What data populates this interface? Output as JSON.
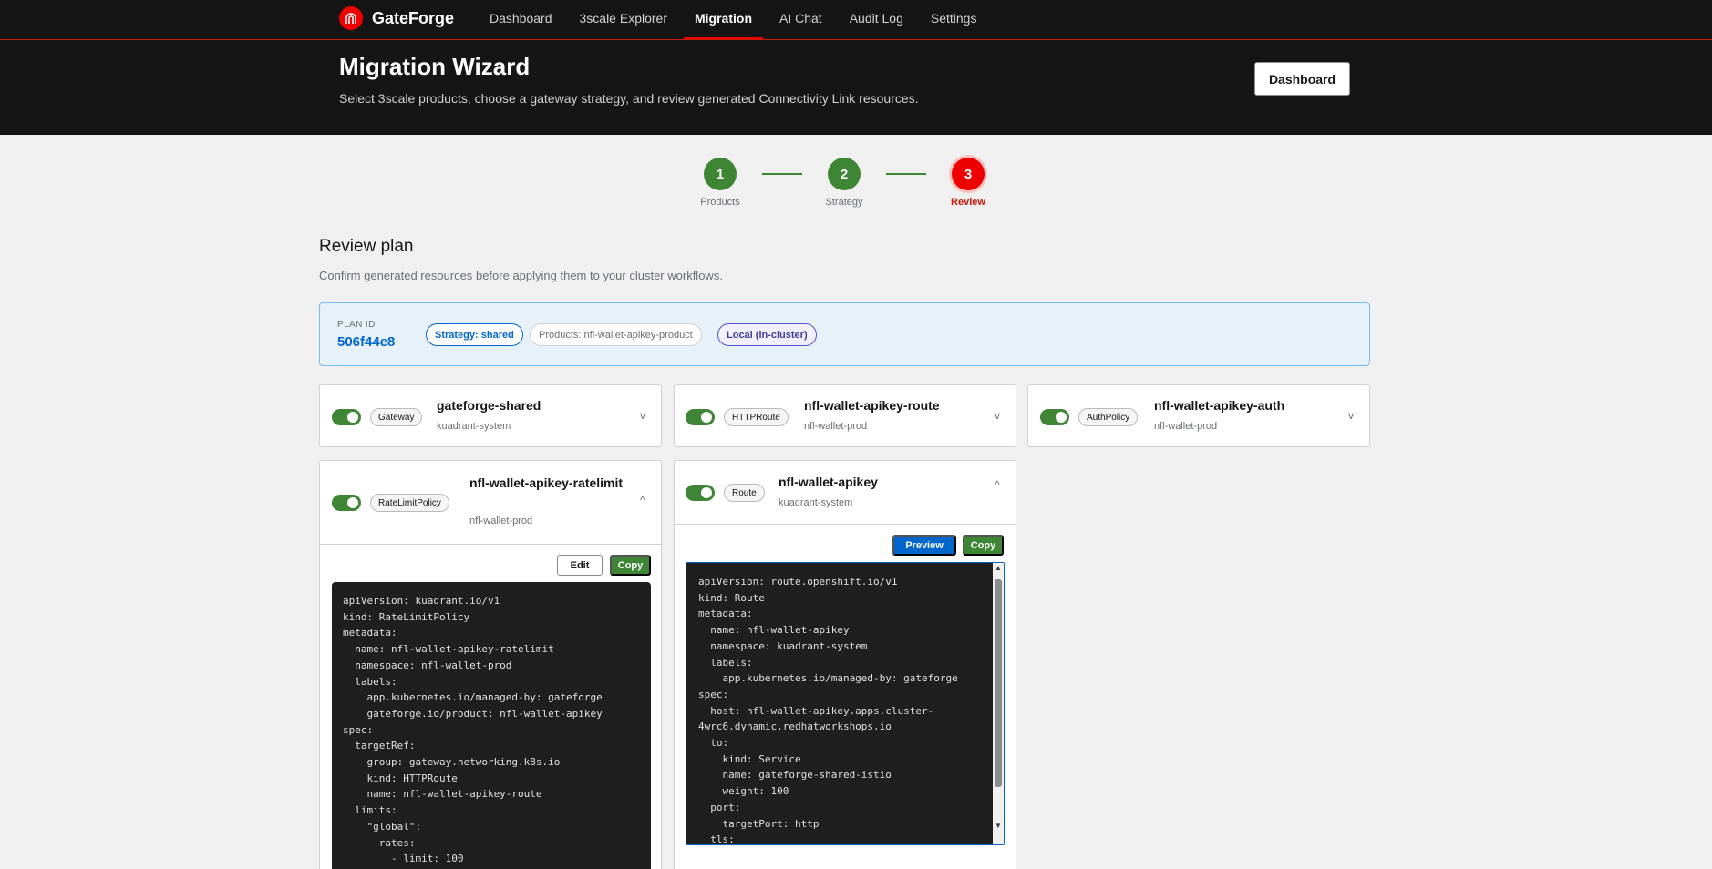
{
  "app": {
    "name": "GateForge"
  },
  "nav": {
    "items": [
      {
        "label": "Dashboard",
        "active": false
      },
      {
        "label": "3scale Explorer",
        "active": false
      },
      {
        "label": "Migration",
        "active": true
      },
      {
        "label": "AI Chat",
        "active": false
      },
      {
        "label": "Audit Log",
        "active": false
      },
      {
        "label": "Settings",
        "active": false
      }
    ]
  },
  "header": {
    "title": "Migration Wizard",
    "subtitle": "Select 3scale products, choose a gateway strategy, and review generated Connectivity Link resources.",
    "dashboard_button": "Dashboard"
  },
  "stepper": {
    "steps": [
      {
        "number": "1",
        "label": "Products",
        "state": "done"
      },
      {
        "number": "2",
        "label": "Strategy",
        "state": "done"
      },
      {
        "number": "3",
        "label": "Review",
        "state": "current"
      }
    ]
  },
  "review": {
    "title": "Review plan",
    "subtitle": "Confirm generated resources before applying them to your cluster workflows."
  },
  "plan": {
    "id_label": "PLAN ID",
    "id": "506f44e8",
    "strategy_chip": "Strategy: shared",
    "products_chip": "Products: nfl-wallet-apikey-product",
    "target_chip": "Local (in-cluster)"
  },
  "resources": [
    {
      "kind": "Gateway",
      "name": "gateforge-shared",
      "namespace": "kuadrant-system",
      "enabled": true,
      "expanded": false
    },
    {
      "kind": "HTTPRoute",
      "name": "nfl-wallet-apikey-route",
      "namespace": "nfl-wallet-prod",
      "enabled": true,
      "expanded": false
    },
    {
      "kind": "AuthPolicy",
      "name": "nfl-wallet-apikey-auth",
      "namespace": "nfl-wallet-prod",
      "enabled": true,
      "expanded": false
    },
    {
      "kind": "RateLimitPolicy",
      "name": "nfl-wallet-apikey-ratelimit",
      "namespace": "nfl-wallet-prod",
      "enabled": true,
      "expanded": true,
      "actions": {
        "edit": "Edit",
        "copy": "Copy"
      },
      "yaml": "apiVersion: kuadrant.io/v1\nkind: RateLimitPolicy\nmetadata:\n  name: nfl-wallet-apikey-ratelimit\n  namespace: nfl-wallet-prod\n  labels:\n    app.kubernetes.io/managed-by: gateforge\n    gateforge.io/product: nfl-wallet-apikey\nspec:\n  targetRef:\n    group: gateway.networking.k8s.io\n    kind: HTTPRoute\n    name: nfl-wallet-apikey-route\n  limits:\n    \"global\":\n      rates:\n        - limit: 100"
    },
    {
      "kind": "Route",
      "name": "nfl-wallet-apikey",
      "namespace": "kuadrant-system",
      "enabled": true,
      "expanded": true,
      "actions": {
        "preview": "Preview",
        "copy": "Copy"
      },
      "yaml": "apiVersion: route.openshift.io/v1\nkind: Route\nmetadata:\n  name: nfl-wallet-apikey\n  namespace: kuadrant-system\n  labels:\n    app.kubernetes.io/managed-by: gateforge\nspec:\n  host: nfl-wallet-apikey.apps.cluster-\n4wrc6.dynamic.redhatworkshops.io\n  to:\n    kind: Service\n    name: gateforge-shared-istio\n    weight: 100\n  port:\n    targetPort: http\n  tls:"
    }
  ],
  "colors": {
    "brand_red": "#ee0000",
    "success_green": "#3e8635",
    "primary_blue": "#0066cc",
    "header_bg": "#151515"
  },
  "icons": {
    "brand_logo": "gateforge-logo-icon",
    "collapsed": "chevron-down-icon",
    "expanded": "chevron-up-icon"
  }
}
